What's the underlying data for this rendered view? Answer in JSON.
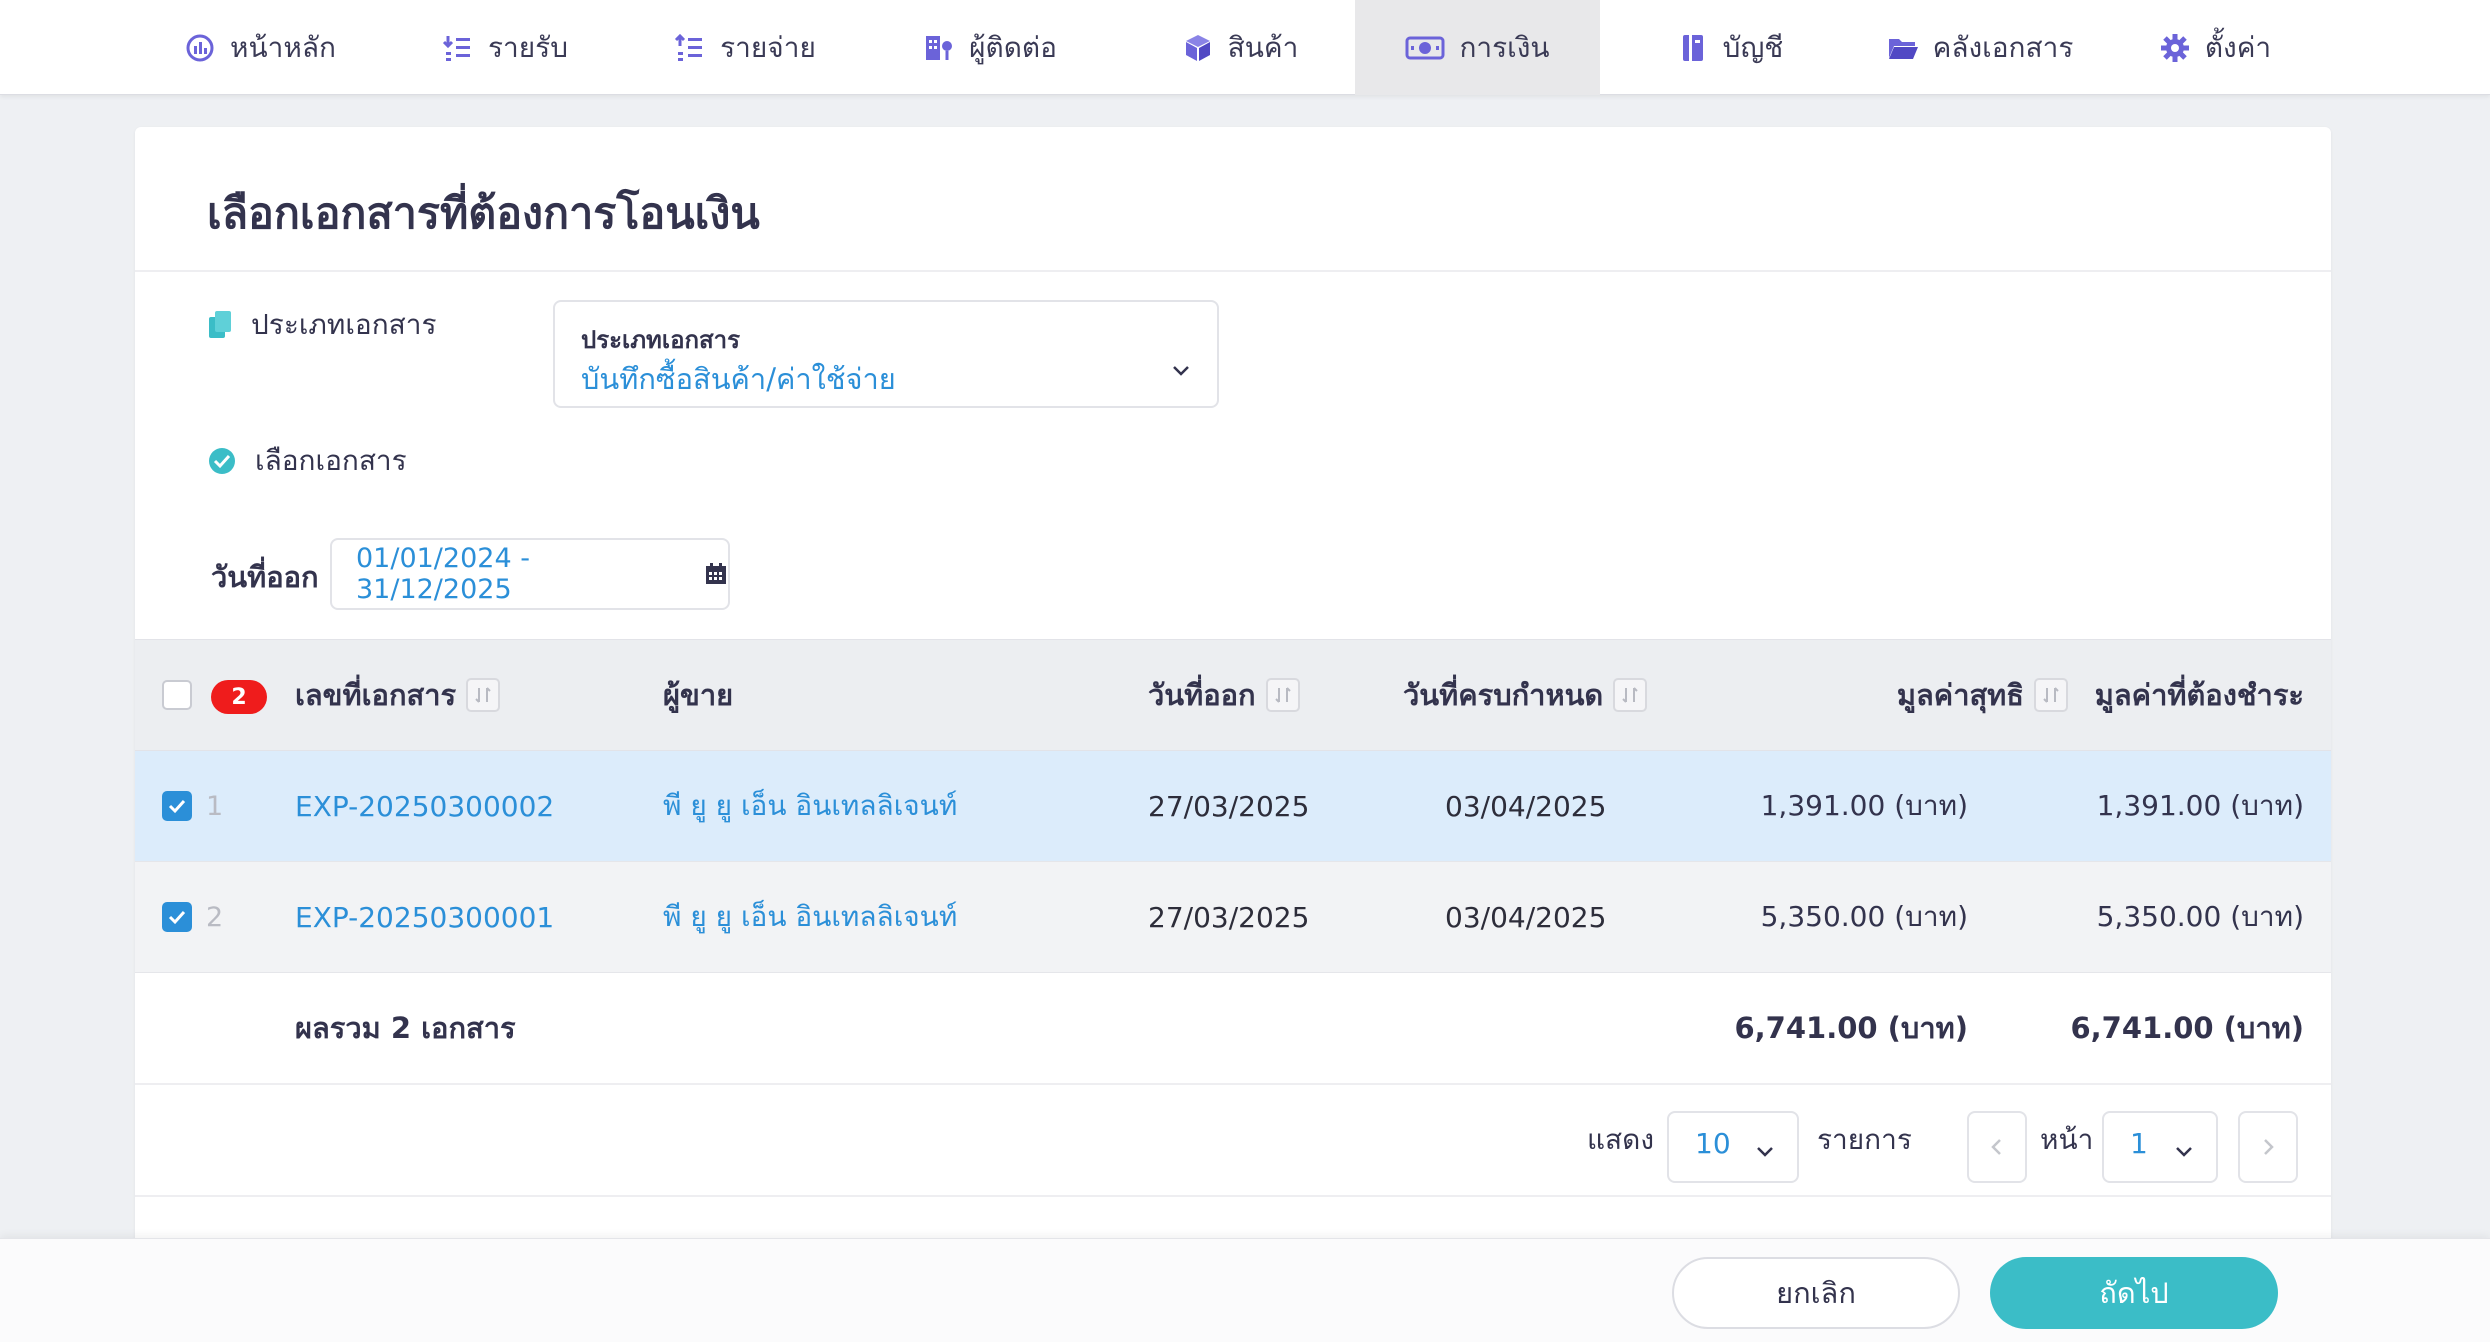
{
  "nav": {
    "items": [
      {
        "label": "หน้าหลัก",
        "icon": "dashboard-gauge-icon",
        "active": false
      },
      {
        "label": "รายรับ",
        "icon": "income-list-icon",
        "active": false
      },
      {
        "label": "รายจ่าย",
        "icon": "expense-list-icon",
        "active": false
      },
      {
        "label": "ผู้ติดต่อ",
        "icon": "contacts-building-icon",
        "active": false
      },
      {
        "label": "สินค้า",
        "icon": "product-box-icon",
        "active": false
      },
      {
        "label": "การเงิน",
        "icon": "finance-money-icon",
        "active": true
      },
      {
        "label": "บัญชี",
        "icon": "accounting-book-icon",
        "active": false
      },
      {
        "label": "คลังเอกสาร",
        "icon": "folder-open-icon",
        "active": false
      },
      {
        "label": "ตั้งค่า",
        "icon": "gear-icon",
        "active": false
      }
    ]
  },
  "page": {
    "title": "เลือกเอกสารที่ต้องการโอนเงิน"
  },
  "doc_type": {
    "section_label": "ประเภทเอกสาร",
    "select_label": "ประเภทเอกสาร",
    "select_value": "บันทึกซื้อสินค้า/ค่าใช้จ่าย"
  },
  "select_docs": {
    "section_label": "เลือกเอกสาร"
  },
  "date_filter": {
    "label": "วันที่ออก",
    "value": "01/01/2024 - 31/12/2025"
  },
  "table": {
    "selected_count": "2",
    "headers": {
      "doc_no": "เลขที่เอกสาร",
      "vendor": "ผู้ขาย",
      "issue_date": "วันที่ออก",
      "due_date": "วันที่ครบกำหนด",
      "net_value": "มูลค่าสุทธิ",
      "amount_due": "มูลค่าที่ต้องชำระ"
    },
    "rows": [
      {
        "num": "1",
        "checked": true,
        "doc_no": "EXP-20250300002",
        "vendor": "พี ยู ยู เอ็น อินเทลลิเจนท์",
        "issue_date": "27/03/2025",
        "due_date": "03/04/2025",
        "net_value": "1,391.00 (บาท)",
        "amount_due": "1,391.00 (บาท)"
      },
      {
        "num": "2",
        "checked": true,
        "doc_no": "EXP-20250300001",
        "vendor": "พี ยู ยู เอ็น อินเทลลิเจนท์",
        "issue_date": "27/03/2025",
        "due_date": "03/04/2025",
        "net_value": "5,350.00 (บาท)",
        "amount_due": "5,350.00 (บาท)"
      }
    ],
    "total": {
      "label": "ผลรวม 2 เอกสาร",
      "net_value": "6,741.00 (บาท)",
      "amount_due": "6,741.00 (บาท)"
    }
  },
  "pagination": {
    "show_label": "แสดง",
    "page_size": "10",
    "items_label": "รายการ",
    "page_label": "หน้า",
    "page": "1"
  },
  "actions": {
    "cancel": "ยกเลิก",
    "next": "ถัดไป"
  },
  "colors": {
    "accent": "#2b8fd8",
    "next_button": "#3bbdc7",
    "badge": "#ef1c1c",
    "nav_icon": "#6b63d9"
  }
}
